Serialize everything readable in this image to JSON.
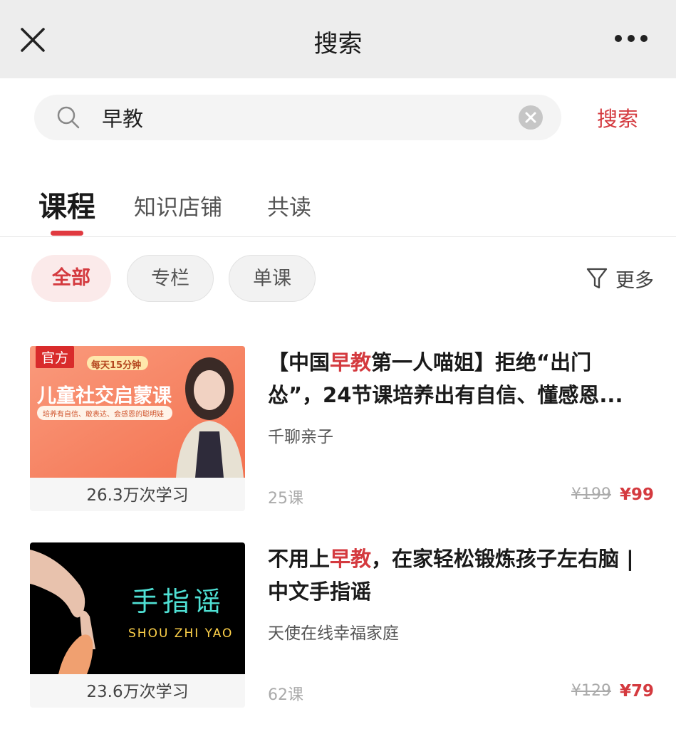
{
  "header": {
    "title": "搜索"
  },
  "search": {
    "query": "早教",
    "submit_label": "搜索"
  },
  "tabs": [
    {
      "label": "课程",
      "active": true
    },
    {
      "label": "知识店铺",
      "active": false
    },
    {
      "label": "共读",
      "active": false
    }
  ],
  "filters": {
    "chips": [
      {
        "label": "全部",
        "active": true
      },
      {
        "label": "专栏",
        "active": false
      },
      {
        "label": "单课",
        "active": false
      }
    ],
    "more_label": "更多"
  },
  "courses": [
    {
      "badge": "官方",
      "thumbnail": {
        "tagline": "每天15分钟",
        "headline": "儿童社交启蒙课",
        "subline": "培养有自信、敢表达、会感恩的聪明娃",
        "bg_color": "#f7886b"
      },
      "study_count": "26.3万次学习",
      "title_pre": "【中国",
      "title_highlight": "早教",
      "title_post": "第一人喵姐】拒绝“出门怂”，24节课培养出有自信、懂感恩...",
      "author": "千聊亲子",
      "lessons": "25课",
      "price_original": "¥199",
      "price_current": "¥99"
    },
    {
      "badge": "",
      "thumbnail": {
        "headline": "手指谣",
        "subline": "SHOU ZHI YAO",
        "bg_color": "#000000"
      },
      "study_count": "23.6万次学习",
      "title_pre": "不用上",
      "title_highlight": "早教",
      "title_post": "，在家轻松锻炼孩子左右脑 | 中文手指谣",
      "author": "天使在线幸福家庭",
      "lessons": "62课",
      "price_original": "¥129",
      "price_current": "¥79"
    }
  ],
  "colors": {
    "accent": "#d43a3f",
    "topbar": "#ededed"
  }
}
